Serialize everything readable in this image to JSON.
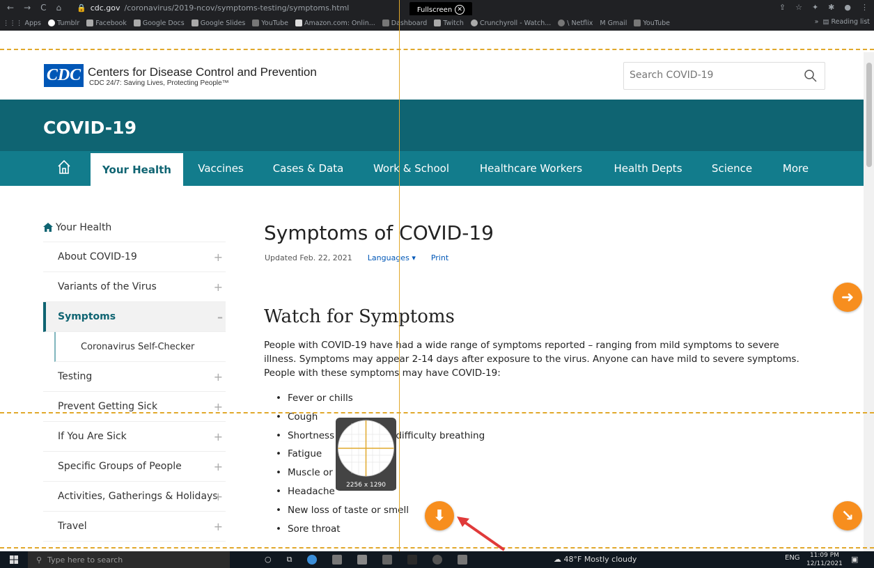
{
  "browser": {
    "url_host": "cdc.gov",
    "url_path": "/coronavirus/2019-ncov/symptoms-testing/symptoms.html",
    "fullscreen_label": "Fullscreen",
    "bookmarks": [
      "Apps",
      "Tumblr",
      "Facebook",
      "Google Docs",
      "Google Slides",
      "YouTube",
      "Amazon.com: Onlin...",
      "Dashboard",
      "Twitch",
      "Crunchyroll - Watch...",
      "Netflix",
      "Gmail",
      "YouTube"
    ],
    "reading_list": "Reading list"
  },
  "header": {
    "logo_text": "CDC",
    "title": "Centers for Disease Control and Prevention",
    "tagline": "CDC 24/7: Saving Lives, Protecting People™",
    "search_placeholder": "Search COVID-19"
  },
  "banner": {
    "title": "COVID-19"
  },
  "nav": {
    "items": [
      "Your Health",
      "Vaccines",
      "Cases & Data",
      "Work & School",
      "Healthcare Workers",
      "Health Depts",
      "Science",
      "More"
    ],
    "active": "Your Health"
  },
  "sidebar": {
    "home_label": "Your Health",
    "items": [
      "About COVID-19",
      "Variants of the Virus",
      "Symptoms",
      "Coronavirus Self-Checker",
      "Testing",
      "Prevent Getting Sick",
      "If You Are Sick",
      "Specific Groups of People",
      "Activities, Gatherings & Holidays",
      "Travel"
    ]
  },
  "main": {
    "title": "Symptoms of COVID-19",
    "updated": "Updated Feb. 22, 2021",
    "languages": "Languages",
    "print": "Print",
    "section_title": "Watch for Symptoms",
    "paragraph": "People with COVID-19 have had a wide range of symptoms reported – ranging from mild symptoms to severe illness. Symptoms may appear 2-14 days after exposure to the virus. Anyone can have mild to severe symptoms. People with these symptoms may have COVID-19:",
    "symptoms": [
      "Fever or chills",
      "Cough",
      "Shortness of breath or difficulty breathing",
      "Fatigue",
      "Muscle or body aches",
      "Headache",
      "New loss of taste or smell",
      "Sore throat"
    ]
  },
  "magnifier": {
    "size_label": "2256 x 1290"
  },
  "taskbar": {
    "search_placeholder": "Type here to search",
    "weather": "48°F  Mostly cloudy",
    "lang": "ENG",
    "time": "11:09 PM",
    "date": "12/11/2021"
  }
}
